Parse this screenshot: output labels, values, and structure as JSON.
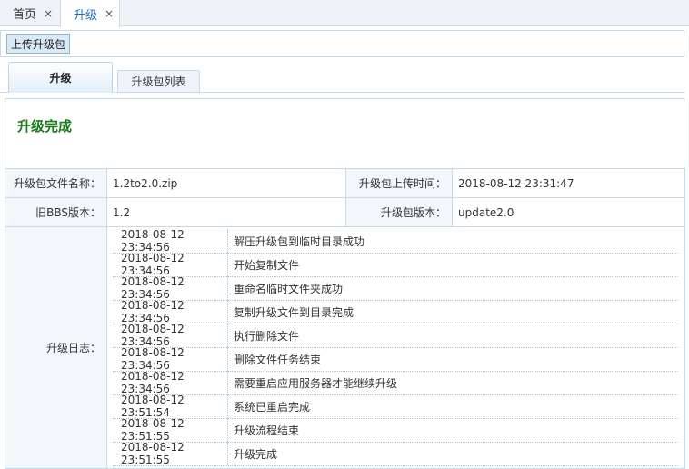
{
  "top_tabs": [
    {
      "label": "首页"
    },
    {
      "label": "升级"
    }
  ],
  "close_glyph": "×",
  "toolbar": {
    "upload_label": "上传升级包"
  },
  "sub_tabs": [
    {
      "label": "升级"
    },
    {
      "label": "升级包列表"
    }
  ],
  "status_title": "升级完成",
  "info": {
    "file_name_label": "升级包文件名称：",
    "file_name_value": "1.2to2.0.zip",
    "upload_time_label": "升级包上传时间：",
    "upload_time_value": "2018-08-12 23:31:47",
    "old_version_label": "旧BBS版本：",
    "old_version_value": "1.2",
    "package_version_label": "升级包版本：",
    "package_version_value": "update2.0",
    "log_label": "升级日志："
  },
  "log": [
    {
      "time": "2018-08-12 23:34:56",
      "message": "解压升级包到临时目录成功"
    },
    {
      "time": "2018-08-12 23:34:56",
      "message": "开始复制文件"
    },
    {
      "time": "2018-08-12 23:34:56",
      "message": "重命名临时文件夹成功"
    },
    {
      "time": "2018-08-12 23:34:56",
      "message": "复制升级文件到目录完成"
    },
    {
      "time": "2018-08-12 23:34:56",
      "message": "执行删除文件"
    },
    {
      "time": "2018-08-12 23:34:56",
      "message": "删除文件任务结束"
    },
    {
      "time": "2018-08-12 23:34:56",
      "message": "需要重启应用服务器才能继续升级"
    },
    {
      "time": "2018-08-12 23:51:54",
      "message": "系统已重启完成"
    },
    {
      "time": "2018-08-12 23:51:55",
      "message": "升级流程结束"
    },
    {
      "time": "2018-08-12 23:51:55",
      "message": "升级完成"
    }
  ],
  "colors": {
    "accent": "#1f6fb6",
    "success": "#1a7d1a",
    "border": "#c6dbea"
  }
}
